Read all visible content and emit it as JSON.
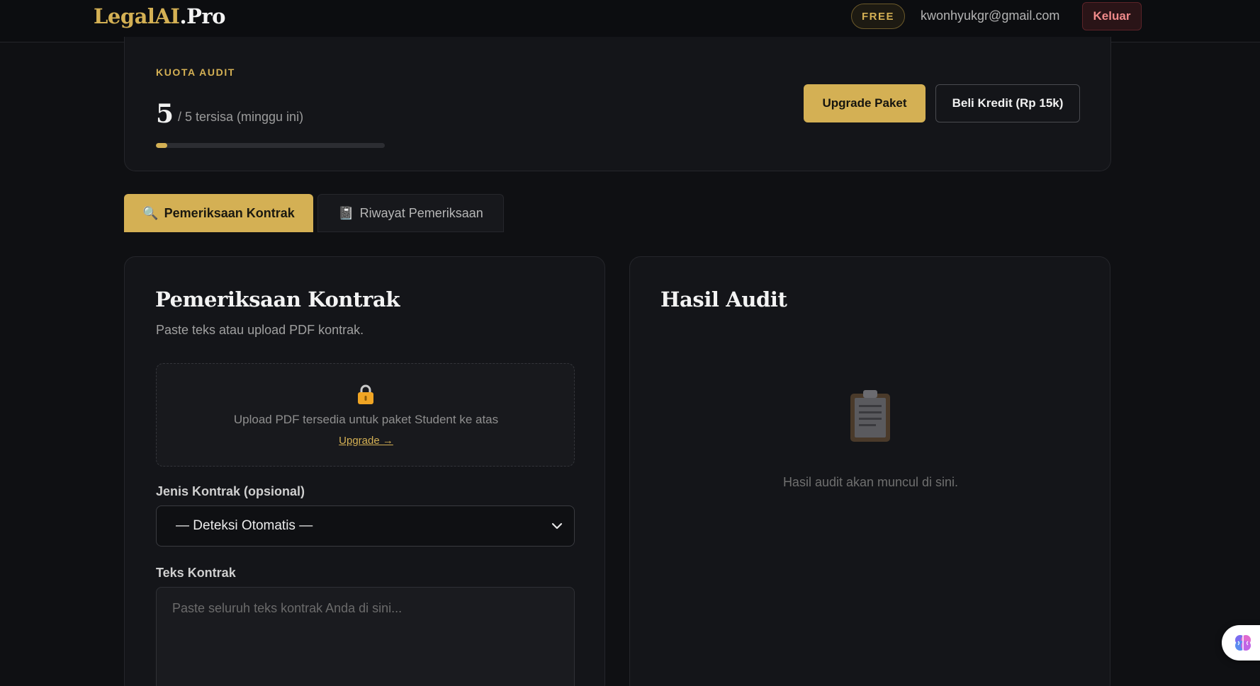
{
  "header": {
    "logo_part1": "LegalAI",
    "logo_part2": ".Pro",
    "plan_badge": "FREE",
    "user_email": "kwonhyukgr@gmail.com",
    "logout_label": "Keluar"
  },
  "quota": {
    "label": "KUOTA AUDIT",
    "remaining": "5",
    "rest_text": "/ 5 tersisa (minggu ini)",
    "progress_fraction": 0.05,
    "upgrade_label": "Upgrade Paket",
    "buy_credit_label": "Beli Kredit (Rp 15k)"
  },
  "tabs": [
    {
      "icon": "magnifier-icon",
      "label": "Pemeriksaan Kontrak",
      "active": true
    },
    {
      "icon": "notebook-icon",
      "label": "Riwayat Pemeriksaan",
      "active": false
    }
  ],
  "form": {
    "title": "Pemeriksaan Kontrak",
    "subtitle": "Paste teks atau upload PDF kontrak.",
    "upload_text": "Upload PDF tersedia untuk paket Student ke atas",
    "upload_link": "Upgrade →",
    "contract_type_label": "Jenis Kontrak (opsional)",
    "contract_type_value": "— Deteksi Otomatis —",
    "contract_text_label": "Teks Kontrak",
    "contract_text_placeholder": "Paste seluruh teks kontrak Anda di sini..."
  },
  "result": {
    "title": "Hasil Audit",
    "empty_text": "Hasil audit akan muncul di sini."
  },
  "colors": {
    "accent": "#d4b054",
    "background": "#0f1013",
    "card": "#141519",
    "danger": "#ef8a8a"
  }
}
